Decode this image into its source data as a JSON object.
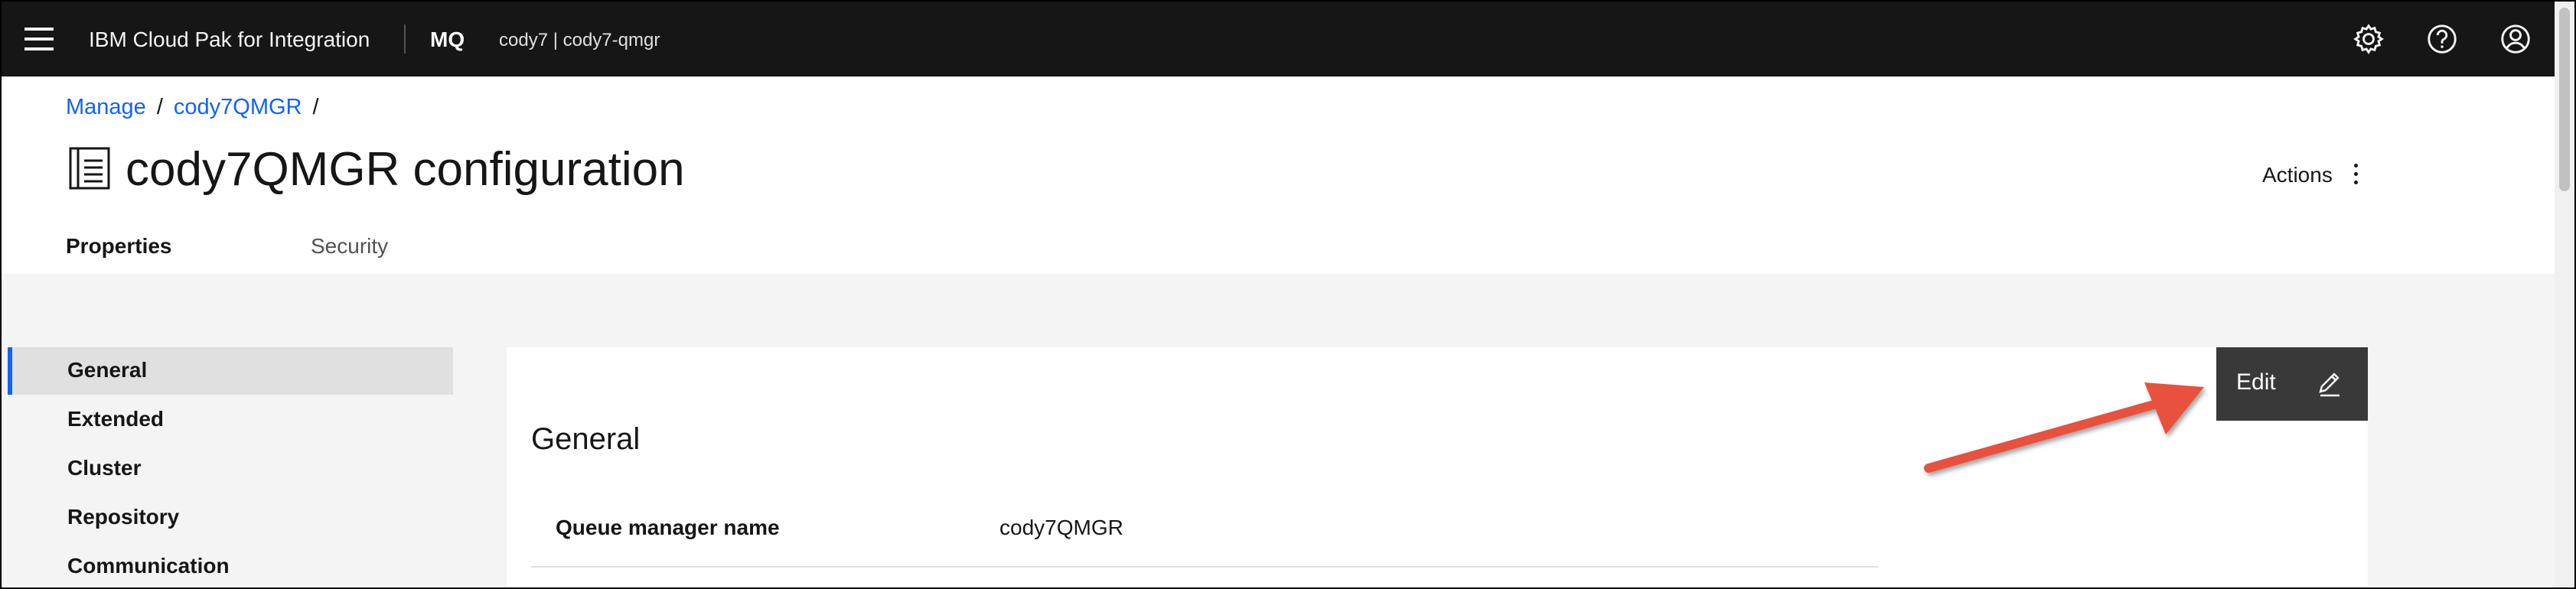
{
  "header": {
    "product_name": "IBM Cloud Pak for Integration",
    "section": "MQ",
    "instance": "cody7 | cody7-qmgr",
    "icons": [
      "menu-icon",
      "settings-icon",
      "help-icon",
      "user-icon"
    ]
  },
  "breadcrumb": {
    "items": [
      "Manage",
      "cody7QMGR"
    ],
    "separator": "/"
  },
  "page": {
    "title": "cody7QMGR configuration",
    "actions_label": "Actions"
  },
  "tabs": [
    {
      "label": "Properties",
      "active": true
    },
    {
      "label": "Security",
      "active": false
    }
  ],
  "sidebar": {
    "items": [
      {
        "label": "General",
        "active": true
      },
      {
        "label": "Extended",
        "active": false
      },
      {
        "label": "Cluster",
        "active": false
      },
      {
        "label": "Repository",
        "active": false
      },
      {
        "label": "Communication",
        "active": false
      }
    ]
  },
  "panel": {
    "title": "General",
    "edit_label": "Edit",
    "fields": [
      {
        "label": "Queue manager name",
        "value": "cody7QMGR"
      }
    ]
  },
  "colors": {
    "header_bg": "#161616",
    "link": "#0f62fe",
    "active_indicator": "#0f62fe",
    "edit_button_bg": "#393939",
    "annotation_arrow": "#e8513d"
  }
}
